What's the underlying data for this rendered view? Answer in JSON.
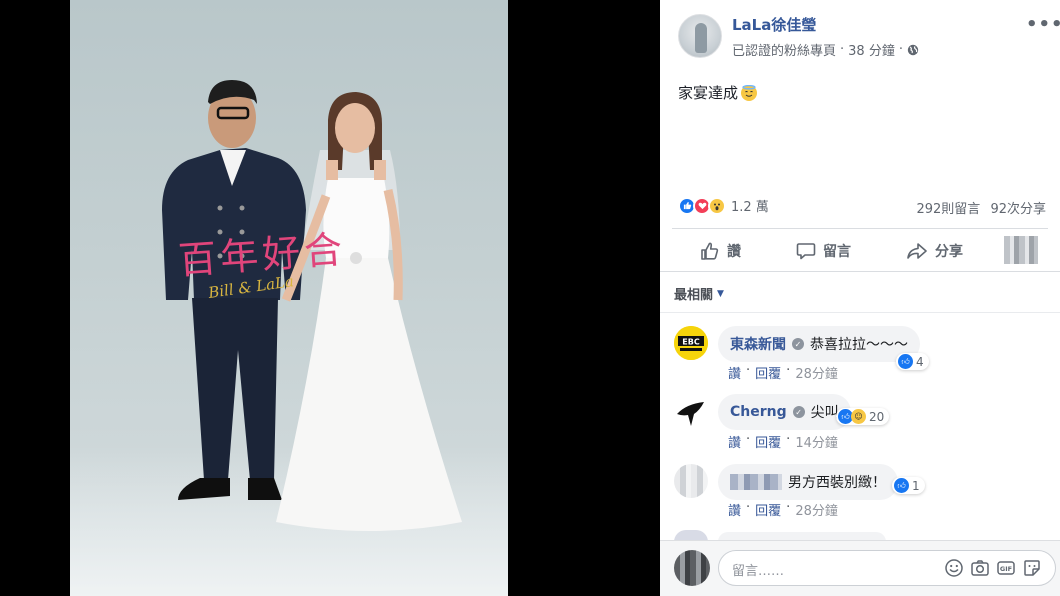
{
  "post": {
    "page_name": "LaLa徐佳瑩",
    "verified_label": "已認證的粉絲專頁",
    "time": "38 分鐘",
    "text": "家宴達成",
    "photo_caption": "百年好合",
    "photo_signature": "Bill & LaLa",
    "reaction_count": "1.2 萬",
    "comment_count": "292則留言",
    "share_count": "92次分享"
  },
  "actions": {
    "like": "讚",
    "comment": "留言",
    "share": "分享"
  },
  "sort": {
    "label": "最相關"
  },
  "comments": [
    {
      "author": "東森新聞",
      "text": "恭喜拉拉～～～",
      "reactions": "4",
      "like": "讚",
      "reply": "回覆",
      "time": "28分鐘"
    },
    {
      "author": "Cherng",
      "text": "尖叫",
      "reactions": "20",
      "like": "讚",
      "reply": "回覆",
      "time": "14分鐘"
    },
    {
      "author": "",
      "text": "男方西裝別緻！",
      "reactions": "1",
      "like": "讚",
      "reply": "回覆",
      "time": "28分鐘"
    }
  ],
  "composer": {
    "placeholder": "留言……"
  },
  "colors": {
    "link": "#385898",
    "like_blue": "#1877f2",
    "love_red": "#f33e58",
    "wow_yellow": "#f7c744"
  }
}
